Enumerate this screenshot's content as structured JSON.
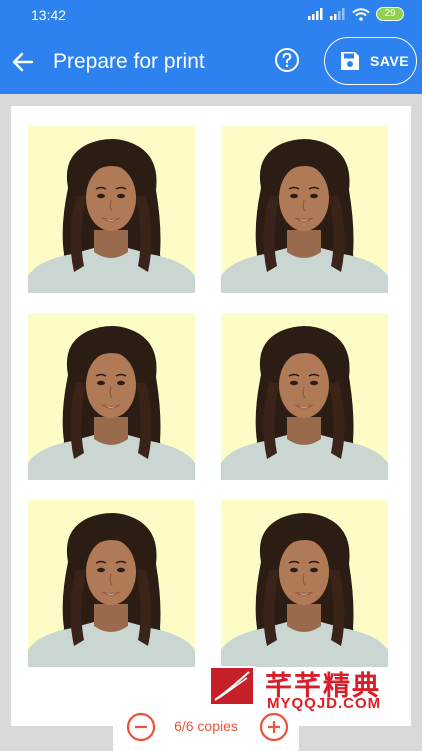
{
  "status_bar": {
    "time": "13:42",
    "battery": "29"
  },
  "app_bar": {
    "title": "Prepare for print",
    "save_label": "SAVE"
  },
  "sheet": {
    "photos": [
      "photo-1",
      "photo-2",
      "photo-3",
      "photo-4",
      "photo-5",
      "photo-6"
    ]
  },
  "copies": {
    "label": "6/6 copies"
  },
  "watermark": {
    "title": "芊芊精典",
    "site": "MYQQJD.COM"
  },
  "colors": {
    "accent": "#2e82f0",
    "photo_bg": "#fdfcc7",
    "stepper": "#e8553a"
  }
}
